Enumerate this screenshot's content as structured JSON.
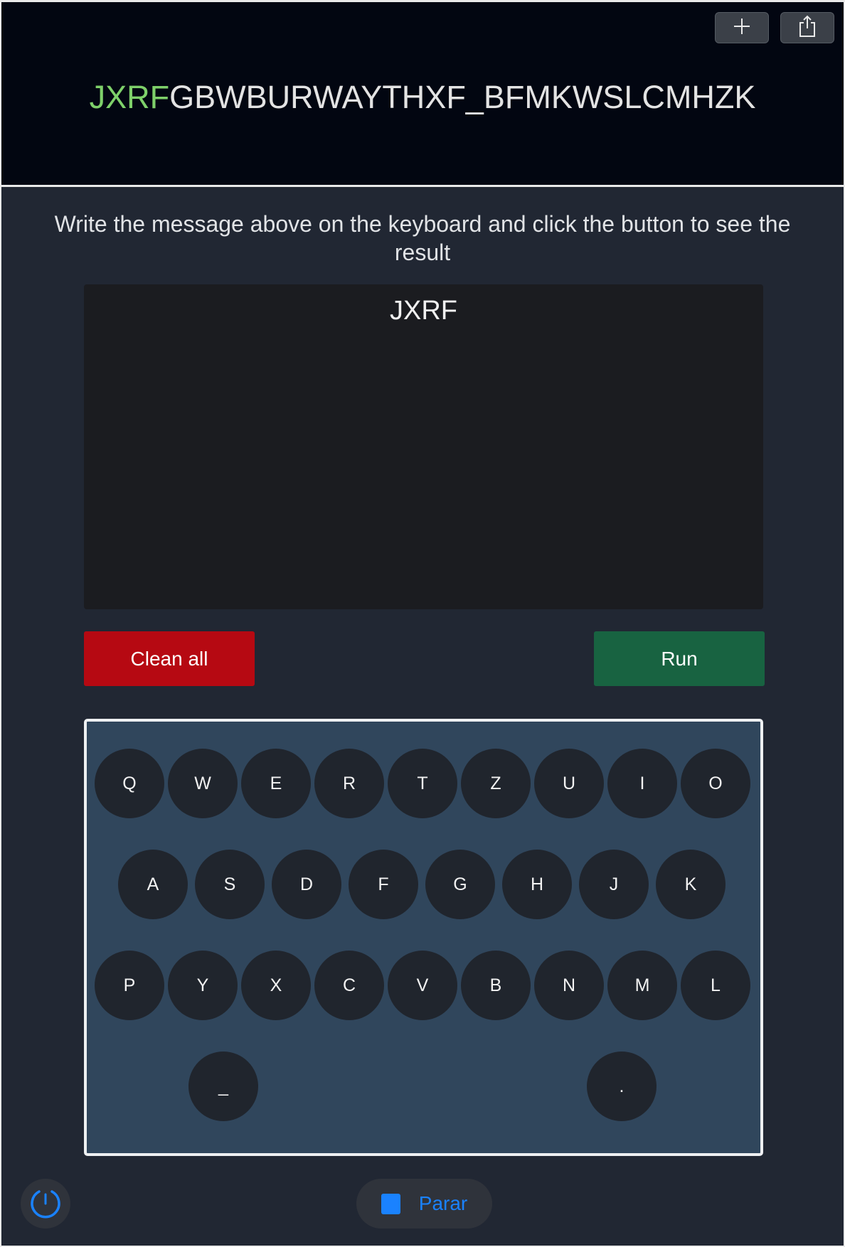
{
  "header": {
    "target_typed": "JXRF",
    "target_remaining": "GBWBURWAYTHXF_BFMKWSLCMHZK",
    "add_icon": "plus-icon",
    "share_icon": "share-icon",
    "typed_color": "#7ed06a"
  },
  "instructions": "Write the message above on the keyboard and click the button to see the result",
  "output": {
    "text": "JXRF"
  },
  "buttons": {
    "clean_label": "Clean all",
    "run_label": "Run",
    "clean_color": "#b60912",
    "run_color": "#186341"
  },
  "keyboard": {
    "row1": [
      "Q",
      "W",
      "E",
      "R",
      "T",
      "Z",
      "U",
      "I",
      "O"
    ],
    "row2": [
      "A",
      "S",
      "D",
      "F",
      "G",
      "H",
      "J",
      "K"
    ],
    "row3": [
      "P",
      "Y",
      "X",
      "C",
      "V",
      "B",
      "N",
      "M",
      "L"
    ],
    "row4": [
      "_",
      "."
    ]
  },
  "footer": {
    "speed_icon": "speedometer-icon",
    "stop_icon": "stop-icon",
    "stop_label": "Parar",
    "accent_color": "#1a82ff"
  }
}
